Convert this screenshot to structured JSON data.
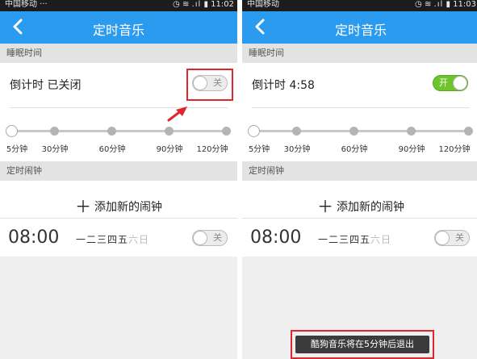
{
  "left": {
    "status": {
      "carrier": "中国移动 ···",
      "time": "11:02"
    },
    "header": {
      "title": "定时音乐"
    },
    "sleep_section": "睡眠时间",
    "countdown": {
      "label": "倒计时 已关闭",
      "toggle_text": "关",
      "toggle_on": false
    },
    "slider": {
      "ticks": [
        "5分钟",
        "30分钟",
        "60分钟",
        "90分钟",
        "120分钟"
      ]
    },
    "alarm_section": "定时闹钟",
    "add_alarm": "添加新的闹钟",
    "alarm": {
      "time": "08:00",
      "days_active": "一二三四五",
      "days_inactive": "六日",
      "toggle_text": "关"
    }
  },
  "right": {
    "status": {
      "carrier": "中国移动",
      "time": "11:03"
    },
    "header": {
      "title": "定时音乐"
    },
    "sleep_section": "睡眠时间",
    "countdown": {
      "label": "倒计时 4:58",
      "toggle_text": "开",
      "toggle_on": true
    },
    "slider": {
      "ticks": [
        "5分钟",
        "30分钟",
        "60分钟",
        "90分钟",
        "120分钟"
      ]
    },
    "alarm_section": "定时闹钟",
    "add_alarm": "添加新的闹钟",
    "alarm": {
      "time": "08:00",
      "days_active": "一二三四五",
      "days_inactive": "六日",
      "toggle_text": "关"
    },
    "toast": "酷狗音乐将在5分钟后退出"
  },
  "colors": {
    "appbar": "#2b9bf0",
    "toggle_on": "#6cc52b",
    "highlight": "#e0262d"
  },
  "icons": {
    "back": "chevron-left-icon",
    "add": "plus-icon",
    "arrow": "arrow-icon"
  }
}
